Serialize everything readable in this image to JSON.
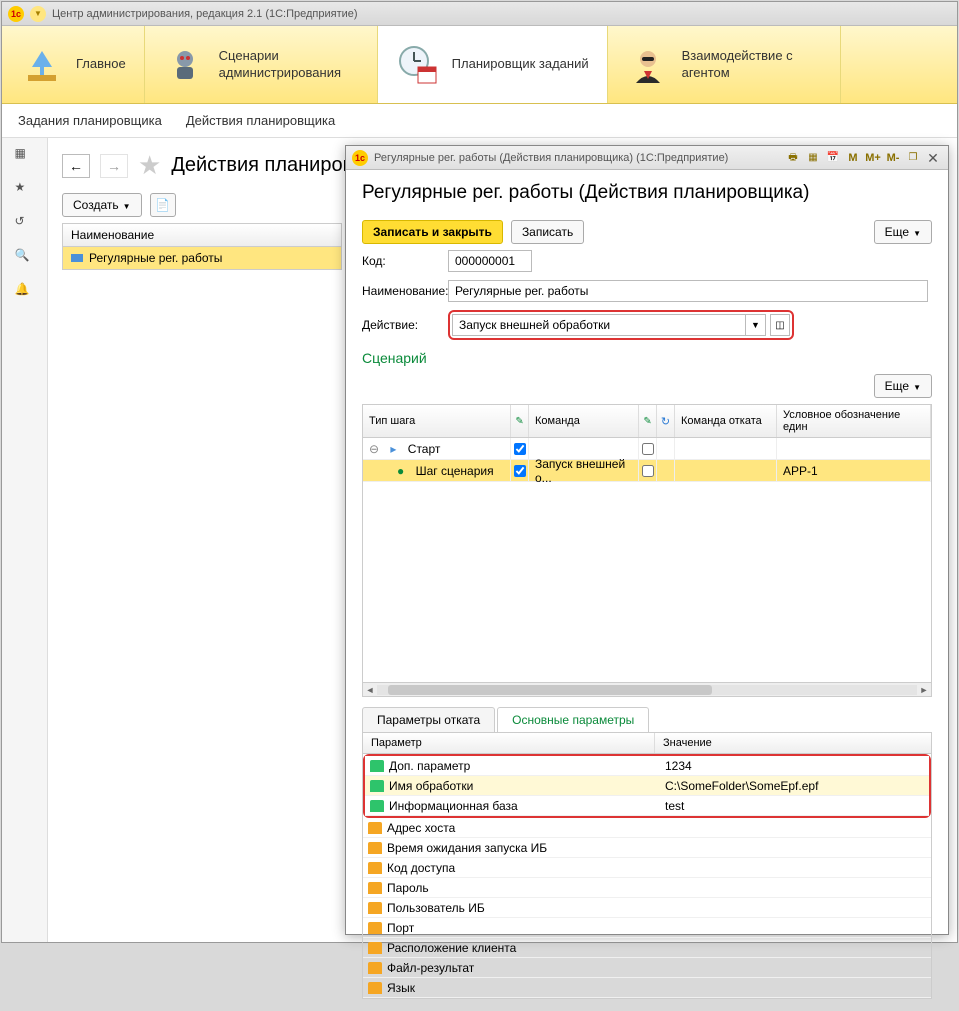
{
  "window": {
    "title": "Центр администрирования, редакция 2.1  (1С:Предприятие)"
  },
  "ribbon": [
    {
      "label": "Главное"
    },
    {
      "label": "Сценарии администрирования"
    },
    {
      "label": "Планировщик заданий"
    },
    {
      "label": "Взаимодействие с агентом"
    }
  ],
  "subnav": {
    "a": "Задания планировщика",
    "b": "Действия планировщика"
  },
  "page": {
    "title": "Действия планировщика",
    "create": "Создать",
    "grid_header": "Наименование",
    "row1": "Регулярные рег. работы"
  },
  "dialog": {
    "title": "Регулярные рег. работы (Действия планировщика)  (1С:Предприятие)",
    "h1": "Регулярные рег. работы (Действия планировщика)",
    "save_close": "Записать и закрыть",
    "save": "Записать",
    "more": "Еще",
    "code_lbl": "Код:",
    "code": "000000001",
    "name_lbl": "Наименование:",
    "name": "Регулярные рег. работы",
    "action_lbl": "Действие:",
    "action": "Запуск внешней обработки",
    "scenario": "Сценарий",
    "cols": {
      "type": "Тип шага",
      "cmd": "Команда",
      "rollback": "Команда отката",
      "cond": "Условное обозначение един"
    },
    "rows": [
      {
        "type": "Старт",
        "cmd": "",
        "rollback": "",
        "cond": "",
        "chk1": true,
        "chk2": false
      },
      {
        "type": "Шаг сценария",
        "cmd": "Запуск внешней о...",
        "rollback": "",
        "cond": "APP-1",
        "chk1": true,
        "chk2": false
      }
    ],
    "tab_rollback": "Параметры отката",
    "tab_main": "Основные параметры",
    "param_cols": {
      "name": "Параметр",
      "val": "Значение"
    },
    "params": [
      {
        "ic": "green",
        "name": "Доп. параметр",
        "val": "1234"
      },
      {
        "ic": "green",
        "name": "Имя обработки",
        "val": "C:\\SomeFolder\\SomeEpf.epf"
      },
      {
        "ic": "green",
        "name": "Информационная база",
        "val": "test"
      },
      {
        "ic": "orange",
        "name": "Адрес хоста",
        "val": ""
      },
      {
        "ic": "orange",
        "name": "Время ожидания запуска ИБ",
        "val": ""
      },
      {
        "ic": "orange",
        "name": "Код доступа",
        "val": ""
      },
      {
        "ic": "orange",
        "name": "Пароль",
        "val": ""
      },
      {
        "ic": "orange",
        "name": "Пользователь ИБ",
        "val": ""
      },
      {
        "ic": "orange",
        "name": "Порт",
        "val": ""
      },
      {
        "ic": "orange",
        "name": "Расположение клиента",
        "val": ""
      },
      {
        "ic": "orange",
        "name": "Файл-результат",
        "val": ""
      },
      {
        "ic": "orange",
        "name": "Язык",
        "val": ""
      }
    ],
    "tb_m": "M",
    "tb_mp": "M+",
    "tb_mm": "M-"
  }
}
